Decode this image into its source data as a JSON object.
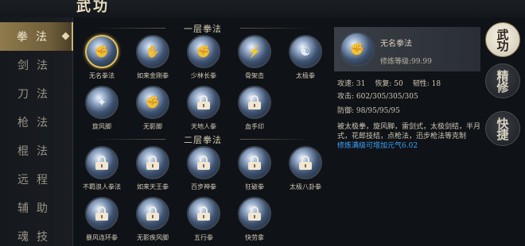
{
  "header": {
    "title": "武功"
  },
  "sidebar": {
    "items": [
      {
        "label": "拳法",
        "active": true
      },
      {
        "label": "剑法",
        "active": false
      },
      {
        "label": "刀法",
        "active": false
      },
      {
        "label": "枪法",
        "active": false
      },
      {
        "label": "棍法",
        "active": false
      },
      {
        "label": "远程",
        "active": false
      },
      {
        "label": "辅助",
        "active": false
      },
      {
        "label": "魂技",
        "active": false
      }
    ]
  },
  "sections": [
    {
      "title": "一层拳法",
      "skills": [
        {
          "name": "无名拳法",
          "locked": false,
          "selected": true,
          "icon": "fist-aura-icon"
        },
        {
          "name": "如来金刚拳",
          "locked": false,
          "selected": false,
          "icon": "palm-strike-icon"
        },
        {
          "name": "少林长拳",
          "locked": false,
          "selected": false,
          "icon": "fist-icon"
        },
        {
          "name": "骨架击",
          "locked": false,
          "selected": false,
          "icon": "lightning-fist-icon"
        },
        {
          "name": "太极拳",
          "locked": false,
          "selected": false,
          "icon": "taiji-icon"
        },
        {
          "name": "旋风脚",
          "locked": false,
          "selected": false,
          "icon": "whirlwind-kick-icon"
        },
        {
          "name": "无影脚",
          "locked": false,
          "selected": false,
          "icon": "shadow-kick-icon"
        },
        {
          "name": "天地人拳",
          "locked": true,
          "selected": false,
          "icon": "lock-icon"
        },
        {
          "name": "血手印",
          "locked": true,
          "selected": false,
          "icon": "lock-icon"
        }
      ]
    },
    {
      "title": "二层拳法",
      "skills": [
        {
          "name": "不羁浪人拳法",
          "locked": true,
          "selected": false,
          "icon": "lock-icon"
        },
        {
          "name": "如来天王拳",
          "locked": true,
          "selected": false,
          "icon": "lock-icon"
        },
        {
          "name": "百步神拳",
          "locked": true,
          "selected": false,
          "icon": "lock-icon"
        },
        {
          "name": "狂破拳",
          "locked": true,
          "selected": false,
          "icon": "lock-icon"
        },
        {
          "name": "太极八卦拳",
          "locked": true,
          "selected": false,
          "icon": "lock-icon"
        },
        {
          "name": "暴风连环拳",
          "locked": true,
          "selected": false,
          "icon": "lock-icon"
        },
        {
          "name": "无影疾风脚",
          "locked": true,
          "selected": false,
          "icon": "lock-icon"
        },
        {
          "name": "五行拳",
          "locked": true,
          "selected": false,
          "icon": "lock-icon"
        },
        {
          "name": "快劳拿",
          "locked": true,
          "selected": false,
          "icon": "lock-icon"
        }
      ]
    }
  ],
  "detail": {
    "name": "无名拳法",
    "level": "修炼等级:99.99",
    "attack_label": "攻速: 31",
    "recover_label": "恢复: 50",
    "hardness_label": "韧性: 18",
    "power_label": "攻击: 602/305/305/305",
    "defense_label": "防御: 98/95/95/95",
    "description": "被太极拳，旋风脚，雷剑式，太极剑结，半月式，花郎技结，点枪法，迅步枪法等克制",
    "note": "修炼满级可增加元气6.02"
  },
  "right_buttons": [
    {
      "label": "武功",
      "active": true
    },
    {
      "label": "精修",
      "active": false
    },
    {
      "label": "快捷",
      "active": false
    }
  ],
  "colors": {
    "accent": "#c9b07a",
    "selected_ring": "#e4c35f",
    "note": "#3ea3ff"
  }
}
